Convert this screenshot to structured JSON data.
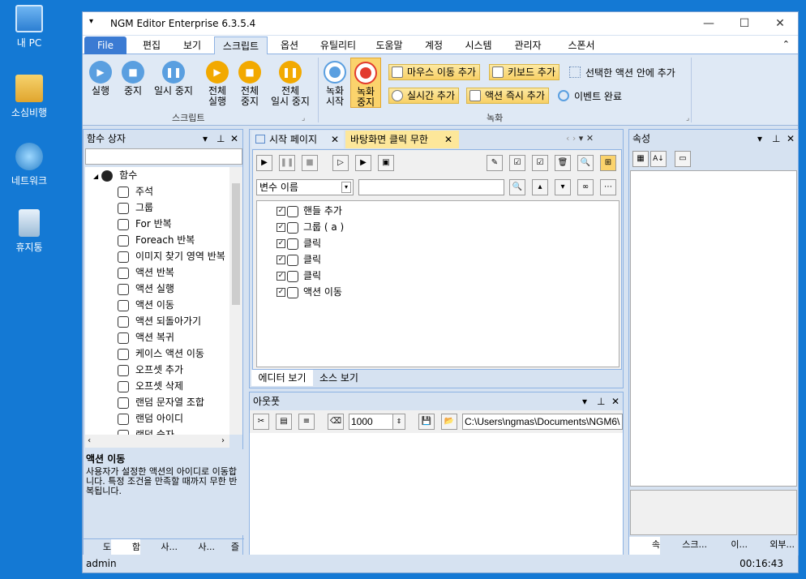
{
  "desktop": [
    "내 PC",
    "소심비행",
    "네트워크",
    "휴지통"
  ],
  "title": "NGM Editor   Enterprise 6.3.5.4",
  "menu": [
    "File",
    "편집",
    "보기",
    "스크립트",
    "옵션",
    "유틸리티",
    "도움말",
    "계정",
    "시스템",
    "관리자",
    "스폰서"
  ],
  "ribbon": {
    "run": "실행",
    "stop": "중지",
    "pause": "일시 중지",
    "all_run": "전체\n실행",
    "all_stop": "전체\n중지",
    "all_pause": "전체\n일시 중지",
    "script_group": "스크립트",
    "rec_start": "녹화\n시작",
    "rec_stop": "녹화\n중지",
    "mouse_add": "마우스 이동 추가",
    "key_add": "키보드 추가",
    "select_add": "선택한 액션 안에 추가",
    "realtime_add": "실시간 추가",
    "instant_add": "액션 즉시 추가",
    "event_done": "이벤트 완료",
    "rec_group": "녹화"
  },
  "func_box": {
    "title": "함수 상자",
    "root": "함수",
    "items": [
      "주석",
      "그룹",
      "For 반복",
      "Foreach 반복",
      "이미지 찾기 영역 반복",
      "액션 반복",
      "액션 실행",
      "액션 이동",
      "액션 되돌아가기",
      "액션 복귀",
      "케이스 액션 이동",
      "오프셋 추가",
      "오프셋 삭제",
      "랜덤 문자열 조합",
      "랜덤 아이디",
      "랜덤 숫자"
    ],
    "desc_title": "액션 이동",
    "desc": "사용자가 설정한 액션의 아이디로 이동합니다. 특정 조건을 만족할 때까지 무한 반복됩니다.",
    "bottom_tabs": [
      "도",
      "함",
      "사...",
      "사...",
      "즐"
    ]
  },
  "doc_tabs": [
    "시작 페이지",
    "바탕화면 클릭 무한"
  ],
  "var_combo": "변수 이름",
  "script_items": [
    "핸들 추가",
    "그룹 ( a )",
    "클릭",
    "클릭",
    "클릭",
    "액션 이동"
  ],
  "editor_tabs": [
    "에디터 보기",
    "소스 보기"
  ],
  "output": {
    "title": "아웃풋",
    "count": "1000",
    "path": "C:\\Users\\ngmas\\Documents\\NGM6\\"
  },
  "props": {
    "title": "속성",
    "bottom_tabs": [
      "속",
      "스크...",
      "이...",
      "외부..."
    ]
  },
  "status": {
    "user": "admin",
    "time": "00:16:43"
  },
  "colors": {
    "run": "#5a9fe0",
    "stop": "#5a9fe0",
    "pause": "#5a9fe0",
    "all": "#f2a900",
    "rec_stop": "#e23b2e"
  }
}
